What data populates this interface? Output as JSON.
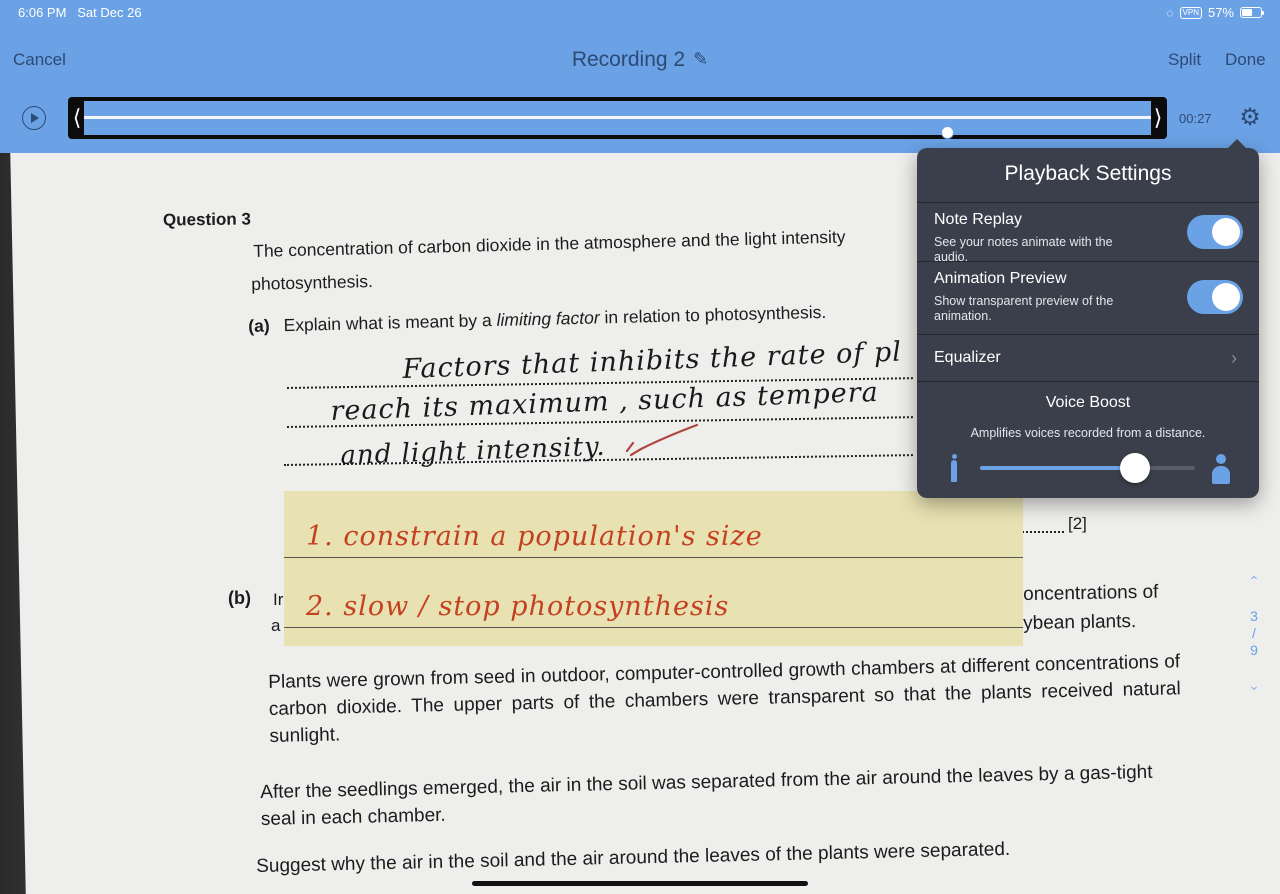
{
  "status_bar": {
    "time": "6:06 PM",
    "date": "Sat Dec 26",
    "vpn": "VPN",
    "battery": "57%",
    "wifi_icon": "wifi-icon",
    "battery_icon": "battery-icon"
  },
  "toolbar": {
    "cancel": "Cancel",
    "title": "Recording 2",
    "split": "Split",
    "done": "Done",
    "pencil_icon": "pencil-icon"
  },
  "player": {
    "elapsed": "00:27",
    "progress": 0.809,
    "play_icon": "play-icon",
    "settings_icon": "gear-icon"
  },
  "document": {
    "question": "Question 3",
    "intro_line1": "The concentration of carbon dioxide in the atmosphere and the light intensity",
    "intro_line2": "photosynthesis.",
    "part_a_label": "(a)",
    "part_a_text_pre": "Explain what is meant by a ",
    "part_a_text_em": "limiting factor",
    "part_a_text_post": " in relation to photosynthesis.",
    "handwriting": [
      "Factors that inhibits the rate of pl",
      "reach its maximum , such as tempera",
      "and light intensity."
    ],
    "marks_a": "[2]",
    "sticky_note": [
      "1. constrain a population's size",
      "2. slow / stop photosynthesis"
    ],
    "part_b_label": "(b)",
    "part_b_frag1": "Ir",
    "part_b_frag2": "a",
    "right_frag1": "oncentrations  of",
    "right_frag2": "ybean plants.",
    "para1": "Plants were grown from seed in outdoor, computer-controlled growth chambers at different concentrations of carbon dioxide. The upper parts of the chambers were transparent so that the plants received natural sunlight.",
    "para2": "After the seedlings emerged, the air in the soil was separated from the air around the leaves by a gas-tight seal in each chamber.",
    "para3": "Suggest why the air in the soil and the air around the leaves of the plants were separated."
  },
  "pager": {
    "current": "3",
    "separator": "/",
    "total": "9",
    "up_icon": "chevron-up-icon",
    "down_icon": "chevron-down-icon"
  },
  "playback_settings": {
    "title": "Playback Settings",
    "note_replay": {
      "title": "Note Replay",
      "subtitle": "See your notes animate with the audio.",
      "on": true
    },
    "animation_preview": {
      "title": "Animation Preview",
      "subtitle": "Show transparent preview of the animation.",
      "on": true
    },
    "equalizer": {
      "title": "Equalizer",
      "chevron_icon": "chevron-right-icon"
    },
    "voice_boost": {
      "title": "Voice Boost",
      "subtitle": "Amplifies voices recorded from a distance.",
      "level": 0.72,
      "min_icon": "person-small-icon",
      "max_icon": "person-large-icon"
    }
  },
  "colors": {
    "accent": "#6ba2e6",
    "popover_bg": "#3a3f4b",
    "sticky_bg": "#e8e2b2",
    "sticky_ink": "#c44020"
  }
}
